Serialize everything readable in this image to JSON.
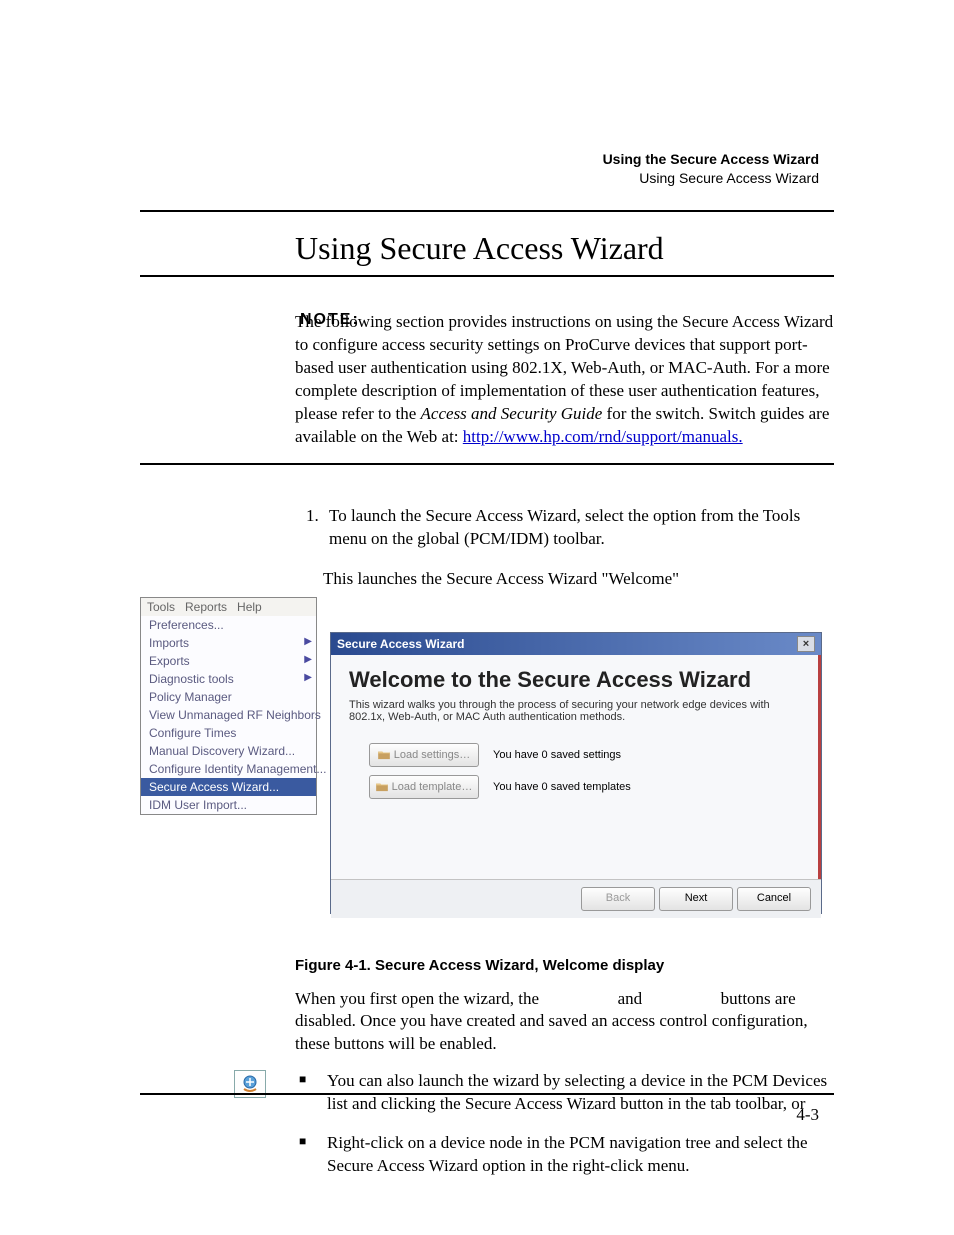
{
  "running_head": {
    "bold": "Using the Secure Access Wizard",
    "sub": "Using Secure Access Wizard"
  },
  "h1": "Using Secure Access Wizard",
  "note": {
    "label": "NOTE:",
    "body_pre": "The following section provides instructions on using the Secure Access Wizard to configure access security settings on ProCurve devices that support port-based user authentication using 802.1X, Web-Auth, or MAC-Auth. For a more complete description of implementation of these user authentication features, please refer to the ",
    "body_ital": "Access and Security Guide",
    "body_post": " for the switch. Switch guides are available on the Web at: ",
    "link": "http://www.hp.com/rnd/support/manuals."
  },
  "step1": "To launch the Secure Access Wizard, select the option from the Tools menu on the global (PCM/IDM) toolbar.",
  "launch_line": "This launches the Secure Access Wizard \"Welcome\"",
  "menu": {
    "bar": [
      "Tools",
      "Reports",
      "Help"
    ],
    "items": [
      {
        "label": "Preferences...",
        "sub": false
      },
      {
        "label": "Imports",
        "sub": true
      },
      {
        "label": "Exports",
        "sub": true
      },
      {
        "label": "Diagnostic tools",
        "sub": true
      },
      {
        "label": "Policy Manager",
        "sub": false
      },
      {
        "label": "View Unmanaged RF Neighbors",
        "sub": false
      },
      {
        "label": "Configure Times",
        "sub": false
      },
      {
        "label": "Manual Discovery Wizard...",
        "sub": false
      },
      {
        "label": "Configure Identity Management...",
        "sub": false
      },
      {
        "label": "Secure Access Wizard...",
        "sub": false,
        "selected": true
      },
      {
        "label": "IDM User Import...",
        "sub": false
      }
    ]
  },
  "wizard": {
    "title": "Secure Access Wizard",
    "heading": "Welcome to the Secure Access Wizard",
    "desc": "This wizard walks you through the process of securing your network edge devices with 802.1x, Web-Auth, or MAC Auth authentication methods.",
    "load_settings_btn": "Load settings…",
    "load_settings_msg": "You have 0 saved settings",
    "load_template_btn": "Load template…",
    "load_template_msg": "You have 0 saved templates",
    "back": "Back",
    "next": "Next",
    "cancel": "Cancel"
  },
  "caption": "Figure 4-1. Secure Access Wizard, Welcome display",
  "after_p_1": "When you first open the wizard, the ",
  "after_p_2": " and ",
  "after_p_3": " buttons are disabled. Once you have created and saved an access control configuration, these buttons will be enabled.",
  "bullet1": "You can also launch the wizard by selecting a device in the PCM Devices list and clicking the Secure Access Wizard button in the tab toolbar, or",
  "bullet2": "Right-click on a device node in the PCM navigation tree and select the Secure Access Wizard option in the right-click menu.",
  "page_num": "4-3"
}
